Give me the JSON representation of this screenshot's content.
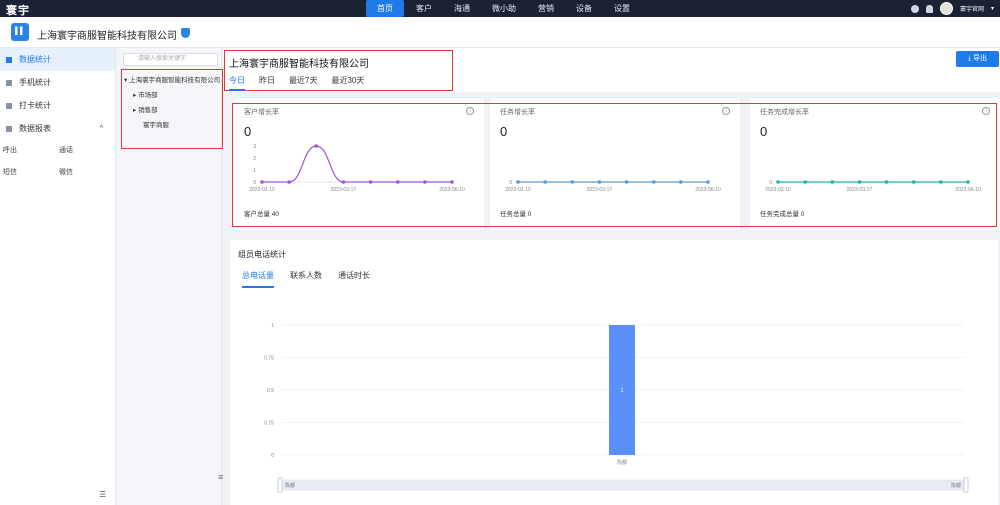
{
  "app": {
    "logo": "寰宇",
    "nav": [
      "首页",
      "客户",
      "海通",
      "微小助",
      "营销",
      "设备",
      "设置"
    ],
    "nav_active": 0,
    "user_name": "寰宇官网"
  },
  "company": {
    "name": "上海寰宇商服智能科技有限公司"
  },
  "sidebar": {
    "items": [
      {
        "label": "数据统计",
        "active": true
      },
      {
        "label": "手机统计",
        "active": false
      },
      {
        "label": "打卡统计",
        "active": false
      },
      {
        "label": "数据报表",
        "active": false,
        "expanded": true
      }
    ],
    "subitems": [
      [
        "呼出",
        "通话"
      ],
      [
        "短信",
        "微信"
      ]
    ]
  },
  "tree": {
    "search_placeholder": "请输入搜索关键字",
    "root": "上海寰宇商服智能科技有限公司",
    "children": [
      "市场部",
      "销售部",
      "寰宇商服"
    ]
  },
  "main": {
    "title": "上海寰宇商服智能科技有限公司",
    "date_tabs": [
      "今日",
      "昨日",
      "最近7天",
      "最近30天"
    ],
    "date_tab_active": 0,
    "export_label": "导出"
  },
  "metrics": [
    {
      "title": "客户增长率",
      "value": "0",
      "footer": "客户总量 40",
      "color": "#9b59d6",
      "chart_data": {
        "type": "line",
        "x_ticks": [
          "2023-03-10",
          "2023-03-17",
          "2023-06-10"
        ],
        "y_ticks": [
          "0",
          "1",
          "2",
          "3"
        ],
        "values": [
          0,
          0,
          3,
          0,
          0,
          0,
          0,
          0
        ]
      }
    },
    {
      "title": "任务增长率",
      "value": "0",
      "footer": "任务总量 0",
      "color": "#5b9bd5",
      "chart_data": {
        "type": "line",
        "x_ticks": [
          "2023-03-10",
          "2023-03-17",
          "2023-06-10"
        ],
        "y_ticks": [
          "0"
        ],
        "values": [
          0,
          0,
          0,
          0,
          0,
          0,
          0,
          0
        ]
      }
    },
    {
      "title": "任务完成增长率",
      "value": "0",
      "footer": "任务完成总量 0",
      "color": "#1fb5a8",
      "chart_data": {
        "type": "line",
        "x_ticks": [
          "2023-03-10",
          "2023-03-17",
          "2023-06-10"
        ],
        "y_ticks": [
          "0"
        ],
        "values": [
          0,
          0,
          0,
          0,
          0,
          0,
          0,
          0
        ]
      }
    }
  ],
  "call_stats": {
    "title": "组员电话统计",
    "tabs": [
      "总电话量",
      "联系人数",
      "通话时长"
    ],
    "tab_active": 0,
    "slider_left": "陈都",
    "slider_right": "陈都",
    "chart_data": {
      "type": "bar",
      "categories": [
        "陈都"
      ],
      "values": [
        1
      ],
      "data_labels": [
        "1"
      ],
      "y_ticks": [
        "1",
        "0.75",
        "0.5",
        "0.25",
        "0"
      ],
      "ylim": [
        0,
        1
      ],
      "color": "#5b8ff9"
    }
  }
}
